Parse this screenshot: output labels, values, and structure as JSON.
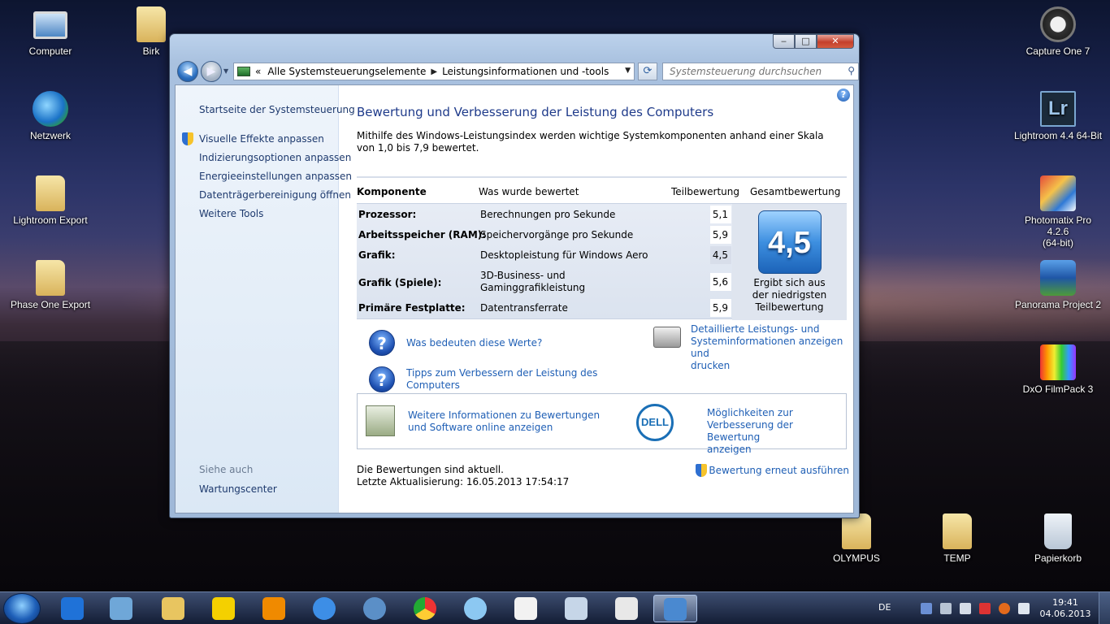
{
  "desktop": {
    "icons_left": [
      {
        "label": "Computer",
        "icon": "computer-icon"
      },
      {
        "label": "Birk",
        "icon": "user-folder-icon"
      },
      {
        "label": "Netzwerk",
        "icon": "network-icon"
      },
      {
        "label": "Lightroom Export",
        "icon": "folder-icon"
      },
      {
        "label": "Phase One Export",
        "icon": "folder-icon"
      }
    ],
    "icons_right": [
      {
        "label": "Capture One 7",
        "icon": "capture-one-icon"
      },
      {
        "label": "Lightroom 4.4 64-Bit",
        "icon": "lightroom-icon"
      },
      {
        "label": "Photomatix Pro 4.2.6",
        "label2": "(64-bit)",
        "icon": "photomatix-icon"
      },
      {
        "label": "Panorama Project 2",
        "icon": "panorama-icon"
      },
      {
        "label": "DxO FilmPack 3",
        "icon": "dxo-icon"
      },
      {
        "label": "OLYMPUS",
        "icon": "folder-icon"
      },
      {
        "label": "TEMP",
        "icon": "folder-icon"
      },
      {
        "label": "Papierkorb",
        "icon": "recycle-bin-icon"
      }
    ],
    "lr_glyph": "Lr"
  },
  "window": {
    "caption_buttons": {
      "minimize": "‒",
      "maximize": "□",
      "close": "✕"
    },
    "address": {
      "prefix": "«",
      "crumbs": [
        "Alle Systemsteuerungselemente",
        "Leistungsinformationen und -tools"
      ]
    },
    "search_placeholder": "Systemsteuerung durchsuchen",
    "help_glyph": "?",
    "sidebar": {
      "home": "Startseite der Systemsteuerung",
      "links": [
        "Visuelle Effekte anpassen",
        "Indizierungsoptionen anpassen",
        "Energieeinstellungen anpassen",
        "Datenträgerbereinigung öffnen",
        "Weitere Tools"
      ],
      "see_also": "Siehe auch",
      "see_also_link": "Wartungscenter"
    },
    "main": {
      "title": "Bewertung und Verbesserung der Leistung des Computers",
      "intro": "Mithilfe des Windows-Leistungsindex werden wichtige Systemkomponenten anhand einer Skala von 1,0 bis 7,9 bewertet.",
      "table": {
        "headers": [
          "Komponente",
          "Was wurde bewertet",
          "Teilbewertung",
          "Gesamtbewertung"
        ],
        "rows": [
          {
            "component": "Prozessor:",
            "rated": "Berechnungen pro Sekunde",
            "score": "5,1"
          },
          {
            "component": "Arbeitsspeicher (RAM):",
            "rated": "Speichervorgänge pro Sekunde",
            "score": "5,9"
          },
          {
            "component": "Grafik:",
            "rated": "Desktopleistung für Windows Aero",
            "score": "4,5"
          },
          {
            "component": "Grafik (Spiele):",
            "rated": "3D-Business- und",
            "rated2": "Gaminggrafikleistung",
            "score": "5,6"
          },
          {
            "component": "Primäre Festplatte:",
            "rated": "Datentransferrate",
            "score": "5,9"
          }
        ],
        "base_score": "4,5",
        "base_caption": [
          "Ergibt sich aus",
          "der niedrigsten",
          "Teilbewertung"
        ]
      },
      "links": {
        "what_mean": "Was bedeuten diese Werte?",
        "tips": [
          "Tipps zum Verbessern der Leistung des",
          "Computers"
        ],
        "details": [
          "Detaillierte Leistungs- und",
          "Systeminformationen anzeigen und",
          "drucken"
        ]
      },
      "promo": {
        "online": [
          "Weitere Informationen zu Bewertungen",
          "und Software online anzeigen"
        ],
        "dell_logo": "DELL",
        "dell_text": [
          "Möglichkeiten zur",
          "Verbesserung der Bewertung",
          "anzeigen"
        ]
      },
      "status": {
        "line1": "Die Bewertungen sind aktuell.",
        "line2": "Letzte Aktualisierung: 16.05.2013 17:54:17",
        "rerun": "Bewertung erneut ausführen"
      }
    }
  },
  "taskbar": {
    "apps": [
      "teamviewer-icon",
      "virtualbox-icon",
      "explorer-icon",
      "lidl-icon",
      "vlc-icon",
      "itunes-icon",
      "thunderbird-icon",
      "chrome-icon",
      "safari-icon",
      "solitaire-icon",
      "calculator-icon",
      "snipping-icon",
      "control-panel-icon"
    ],
    "language": "DE",
    "time": "19:41",
    "date": "04.06.2013"
  }
}
